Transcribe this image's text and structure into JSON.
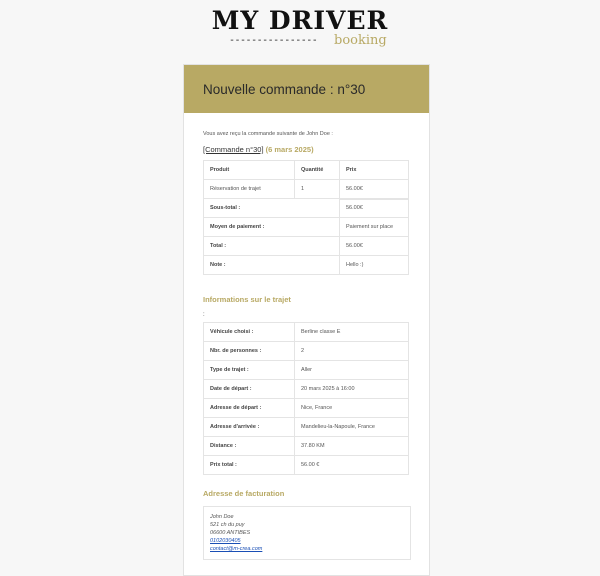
{
  "logo": {
    "title": "MY DRIVER",
    "dashes": "----------------",
    "subtitle": "booking"
  },
  "header": {
    "title": "Nouvelle commande : n°30"
  },
  "intro": "Vous avez reçu la commande suivante de John Doe :",
  "order": {
    "link_text": "[Commande n°30]",
    "date": "(6 mars 2025)"
  },
  "order_table": {
    "headers": [
      "Produit",
      "Quantité",
      "Prix"
    ],
    "item": {
      "product": "Réservation de trajet",
      "qty": "1",
      "price": "56.00€"
    },
    "totals": [
      {
        "label": "Sous-total :",
        "value": "56.00€"
      },
      {
        "label": "Moyen de paiement :",
        "value": "Paiement sur place"
      },
      {
        "label": "Total :",
        "value": "56.00€"
      },
      {
        "label": "Note :",
        "value": "Hello :)"
      }
    ]
  },
  "trip": {
    "title": "Informations sur le trajet",
    "colon": ":",
    "rows": [
      {
        "label": "Véhicule choisi :",
        "value": "Berline classe E"
      },
      {
        "label": "Nbr. de personnes :",
        "value": "2"
      },
      {
        "label": "Type de trajet :",
        "value": "Aller"
      },
      {
        "label": "Date de départ :",
        "value": "20 mars 2025 à 16:00"
      },
      {
        "label": "Adresse de départ :",
        "value": "Nice, France"
      },
      {
        "label": "Adresse d'arrivée :",
        "value": "Mandelieu-la-Napoule, France"
      },
      {
        "label": "Distance :",
        "value": "37.80 KM"
      },
      {
        "label": "Prix total :",
        "value": "56.00 €"
      }
    ]
  },
  "billing": {
    "title": "Adresse de facturation",
    "name": "John Doe",
    "street": "521 ch du puy",
    "city": "06600 ANTIBES",
    "phone": "0102030405",
    "email": "contact@m-crea.com"
  }
}
